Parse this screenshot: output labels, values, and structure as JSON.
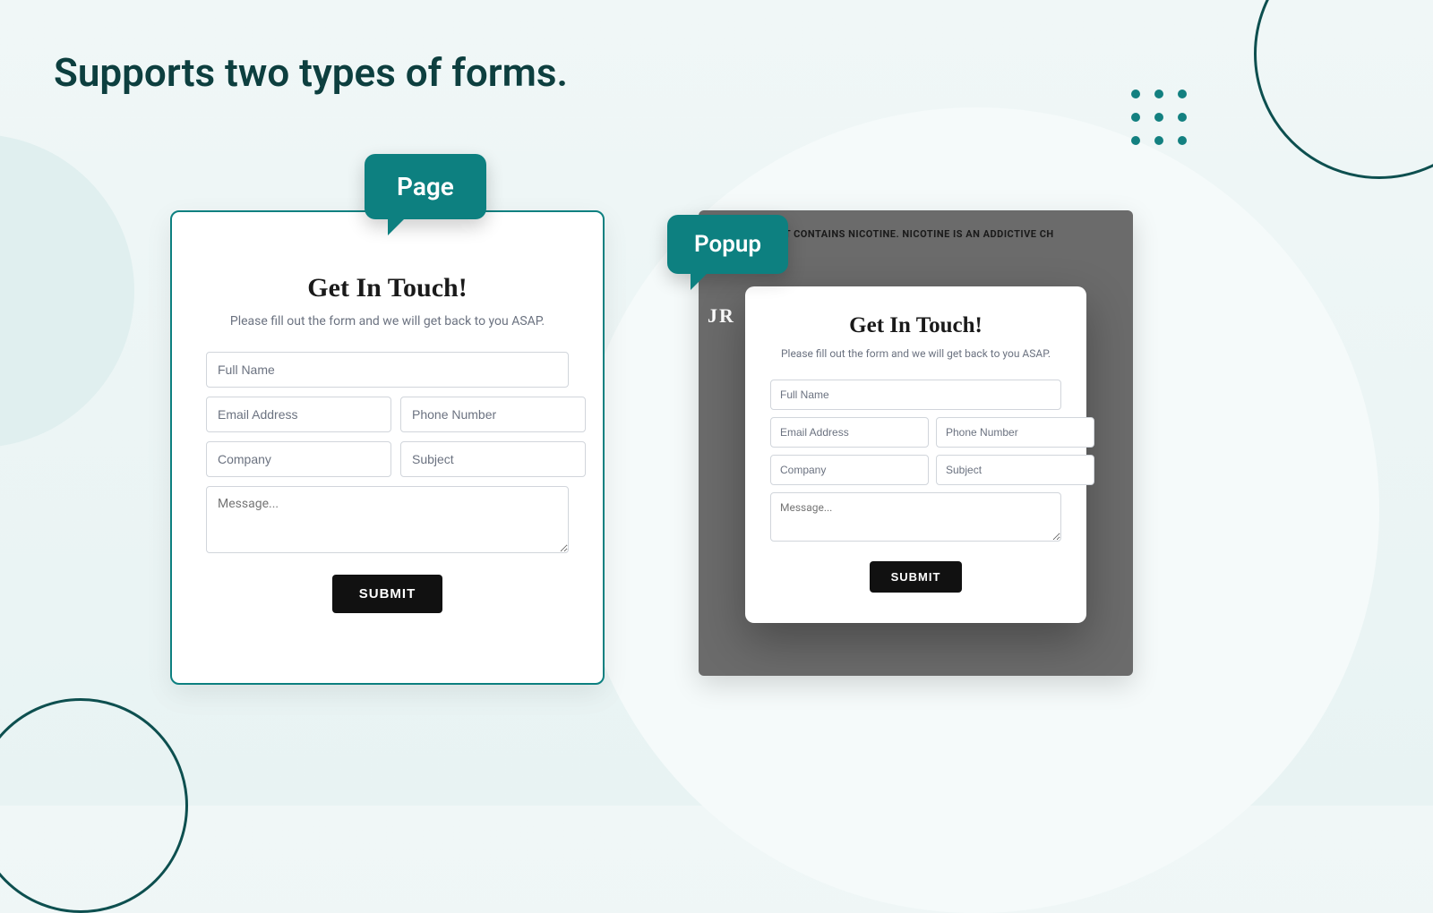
{
  "heading": "Supports two types of forms.",
  "labels": {
    "page": "Page",
    "popup": "Popup"
  },
  "form": {
    "title": "Get In Touch!",
    "subtitle": "Please fill out the form and we will get back to you ASAP.",
    "placeholders": {
      "full_name": "Full Name",
      "email": "Email Address",
      "phone": "Phone Number",
      "company": "Company",
      "subject": "Subject",
      "message": "Message..."
    },
    "submit": "SUBMIT"
  },
  "popup_backdrop": {
    "warning": "CT CONTAINS NICOTINE. NICOTINE IS AN ADDICTIVE CH",
    "logo_fragment": "JR"
  },
  "colors": {
    "teal": "#0d8080",
    "dark_teal": "#0d3f3f",
    "button_bg": "#111111"
  }
}
